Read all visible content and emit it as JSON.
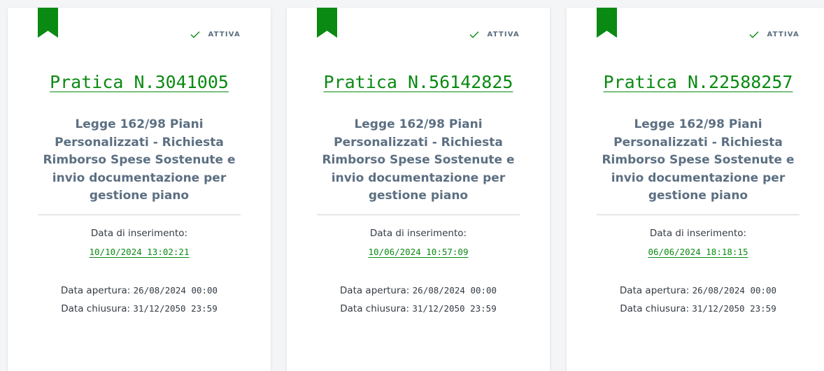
{
  "colors": {
    "accent_green": "#0a8a12",
    "slate_text": "#5c6f82",
    "body_text": "#333b44"
  },
  "cards": [
    {
      "status": "ATTIVA",
      "title": "Pratica N.3041005",
      "description": "Legge 162/98 Piani Personalizzati - Richiesta Rimborso Spese Sostenute e invio documentazione per gestione piano",
      "inserimento_label": "Data di inserimento:",
      "inserimento_date": "10/10/2024 13:02:21",
      "apertura_label": "Data apertura:",
      "apertura_value": "26/08/2024 00:00",
      "chiusura_label": "Data chiusura:",
      "chiusura_value": "31/12/2050 23:59"
    },
    {
      "status": "ATTIVA",
      "title": "Pratica N.56142825",
      "description": "Legge 162/98 Piani Personalizzati - Richiesta Rimborso Spese Sostenute e invio documentazione per gestione piano",
      "inserimento_label": "Data di inserimento:",
      "inserimento_date": "10/06/2024 10:57:09",
      "apertura_label": "Data apertura:",
      "apertura_value": "26/08/2024 00:00",
      "chiusura_label": "Data chiusura:",
      "chiusura_value": "31/12/2050 23:59"
    },
    {
      "status": "ATTIVA",
      "title": "Pratica N.22588257",
      "description": "Legge 162/98 Piani Personalizzati - Richiesta Rimborso Spese Sostenute e invio documentazione per gestione piano",
      "inserimento_label": "Data di inserimento:",
      "inserimento_date": "06/06/2024 18:18:15",
      "apertura_label": "Data apertura:",
      "apertura_value": "26/08/2024 00:00",
      "chiusura_label": "Data chiusura:",
      "chiusura_value": "31/12/2050 23:59"
    }
  ]
}
